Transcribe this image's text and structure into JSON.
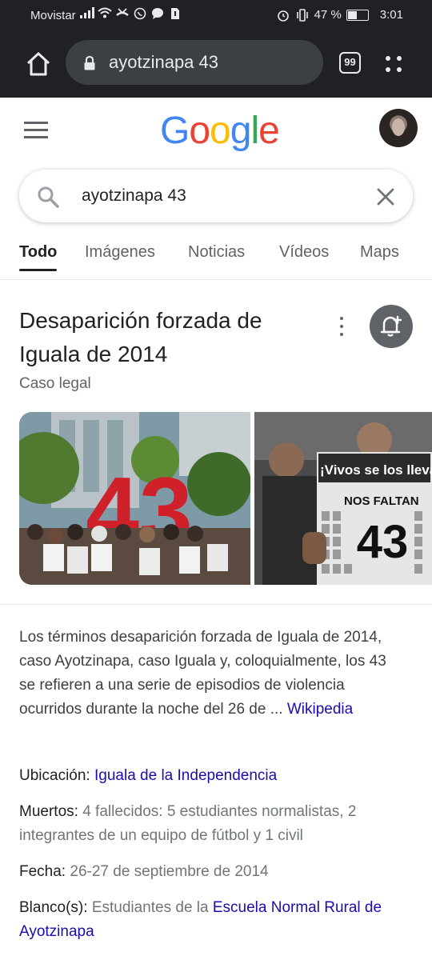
{
  "status_bar": {
    "carrier": "Movistar",
    "battery": "47 %",
    "battery_level": 0.47,
    "time": "3:01",
    "icons": [
      "signal-icon",
      "wifi-icon",
      "missed-call-icon",
      "whatsapp-icon",
      "message-icon",
      "sim-icon",
      "alarm-icon",
      "vibrate-icon",
      "battery-icon"
    ]
  },
  "browser": {
    "url": "ayotzinapa 43",
    "tab_count": "99",
    "icons": [
      "home-icon",
      "lock-icon",
      "tabs-icon",
      "more-vert-icon"
    ]
  },
  "google": {
    "logo": {
      "letters": [
        "G",
        "o",
        "o",
        "g",
        "l",
        "e"
      ],
      "colors": [
        "#4285F4",
        "#EA4335",
        "#FBBC05",
        "#4285F4",
        "#34A853",
        "#EA4335"
      ]
    }
  },
  "search": {
    "query": "ayotzinapa 43"
  },
  "tabs": [
    {
      "label": "Todo",
      "active": true
    },
    {
      "label": "Imágenes",
      "active": false
    },
    {
      "label": "Noticias",
      "active": false
    },
    {
      "label": "Vídeos",
      "active": false
    },
    {
      "label": "Maps",
      "active": false
    }
  ],
  "knowledge_panel": {
    "title_line1": "Desaparición forzada de",
    "title_line2": "Iguala de 2014",
    "subtitle": "Caso legal",
    "image2_sign_line1": "¡Vivos se los llevaron",
    "image2_sign_line2": "NOS FALTAN",
    "image2_sign_line3": "43",
    "image1_sculpture": "43",
    "description": "Los términos desaparición forzada de Iguala de 2014, caso Ayotzinapa, caso Iguala y, coloquialmente, los 43 se refieren a una serie de episodios de violencia ocurridos durante la noche del 26 de ... ",
    "description_source": "Wikipedia",
    "facts": {
      "ubicacion_label": "Ubicación:",
      "ubicacion_value": "Iguala de la Independencia",
      "muertos_label": "Muertos:",
      "muertos_value": "4 fallecidos: 5 estudiantes normalistas, 2 integrantes de un equipo de fútbol y 1 civil",
      "fecha_label": "Fecha:",
      "fecha_value": "26-27 de septiembre de 2014",
      "blanco_label": "Blanco(s):",
      "blanco_value_text": "Estudiantes de la ",
      "blanco_value_link": "Escuela Normal Rural de Ayotzinapa"
    }
  },
  "colors": {
    "link": "#1a0dab",
    "chrome_dark": "#202124",
    "url_box": "#3c4043"
  }
}
